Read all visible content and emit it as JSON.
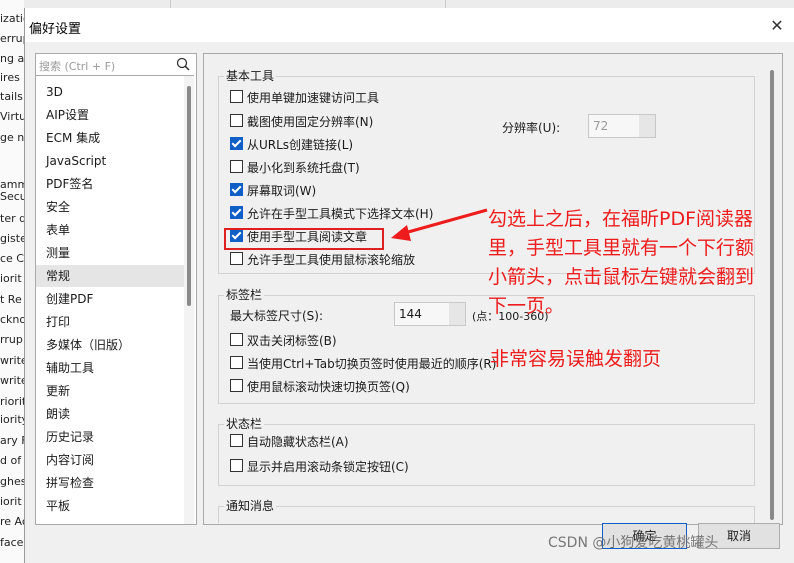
{
  "background": {
    "lines": [
      "ization",
      "errup",
      "ng ar",
      "ires o",
      "tails c",
      "Virtu",
      "ge n",
      "amm",
      "Secu",
      "ter d",
      "giste",
      "ce C",
      "iorit",
      "t Re",
      "ckno",
      "rrup",
      "write",
      "write",
      "riority",
      "iority",
      "ary F",
      "d of",
      "ghes",
      "iorit",
      "re Ac",
      "face"
    ]
  },
  "dialog": {
    "title": "偏好设置",
    "close": "✕"
  },
  "search": {
    "placeholder": "搜索 (Ctrl + F)"
  },
  "nav": {
    "items": [
      "3D",
      "AIP设置",
      "ECM 集成",
      "JavaScript",
      "PDF签名",
      "安全",
      "表单",
      "测量",
      "常规",
      "创建PDF",
      "打印",
      "多媒体（旧版）",
      "辅助工具",
      "更新",
      "朗读",
      "历史记录",
      "内容订阅",
      "拼写检查",
      "平板"
    ],
    "selected": "常规"
  },
  "basic_tools": {
    "title": "基本工具",
    "options": [
      {
        "label": "使用单键加速键访问工具",
        "checked": false
      },
      {
        "label": "截图使用固定分辨率(N)",
        "checked": false
      },
      {
        "label": "从URLs创建链接(L)",
        "checked": true
      },
      {
        "label": "最小化到系统托盘(T)",
        "checked": false
      },
      {
        "label": "屏幕取词(W)",
        "checked": true
      },
      {
        "label": "允许在手型工具模式下选择文本(H)",
        "checked": true
      },
      {
        "label": "使用手型工具阅读文章",
        "checked": true
      },
      {
        "label": "允许手型工具使用鼠标滚轮缩放",
        "checked": false
      }
    ],
    "resolution_label": "分辨率(U):",
    "resolution_value": "72"
  },
  "tab_bar": {
    "title": "标签栏",
    "max_size_label": "最大标签尺寸(S):",
    "max_size_value": "144",
    "max_size_hint": "(点：100-360)",
    "options": [
      {
        "label": "双击关闭标签(B)",
        "checked": false
      },
      {
        "label": "当使用Ctrl+Tab切换页签时使用最近的顺序(R)",
        "checked": false
      },
      {
        "label": "使用鼠标滚动快速切换页签(Q)",
        "checked": false
      }
    ]
  },
  "status_bar": {
    "title": "状态栏",
    "options": [
      {
        "label": "自动隐藏状态栏(A)",
        "checked": false
      },
      {
        "label": "显示并启用滚动条锁定按钮(C)",
        "checked": false
      }
    ]
  },
  "notify": {
    "title": "通知消息"
  },
  "annotation": {
    "text": "勾选上之后，在福昕PDF阅读器里，手型工具里就有一个下行额小箭头，点击鼠标左键就会翻到下一页。",
    "lines": [
      "勾选上之后，在福昕PDF阅读器",
      "里，手型工具里就有一个下行额",
      "小箭头，点击鼠标左键就会翻到",
      "下一页。"
    ],
    "warning": "非常容易误触发翻页",
    "color": "#ee1c1c"
  },
  "buttons": {
    "ok": "确定",
    "cancel": "取消"
  },
  "watermark": "CSDN @小狗爱吃黄桃罐头"
}
